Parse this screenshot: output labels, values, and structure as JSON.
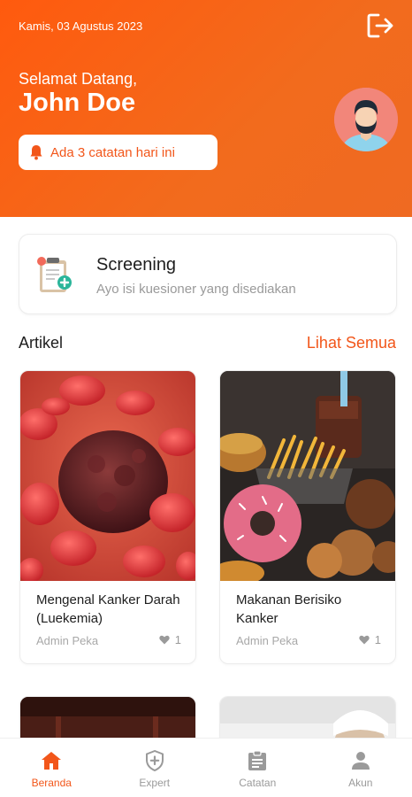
{
  "header": {
    "date": "Kamis, 03 Agustus 2023",
    "greeting": "Selamat Datang,",
    "username": "John Doe",
    "notification": "Ada 3 catatan hari ini"
  },
  "screening": {
    "title": "Screening",
    "subtitle": "Ayo isi kuesioner yang disediakan"
  },
  "articles": {
    "section_title": "Artikel",
    "see_all": "Lihat Semua",
    "items": [
      {
        "title": "Mengenal Kanker Darah (Luekemia)",
        "author": "Admin Peka",
        "likes": "1"
      },
      {
        "title": "Makanan Berisiko Kanker",
        "author": "Admin Peka",
        "likes": "1"
      }
    ]
  },
  "nav": {
    "items": [
      {
        "label": "Beranda",
        "icon": "home-icon",
        "active": true
      },
      {
        "label": "Expert",
        "icon": "shield-plus-icon",
        "active": false
      },
      {
        "label": "Catatan",
        "icon": "clipboard-icon",
        "active": false
      },
      {
        "label": "Akun",
        "icon": "person-icon",
        "active": false
      }
    ]
  },
  "colors": {
    "accent": "#f2561a",
    "header_gradient_start": "#ff5a0e",
    "muted_text": "#9a9a9a"
  }
}
